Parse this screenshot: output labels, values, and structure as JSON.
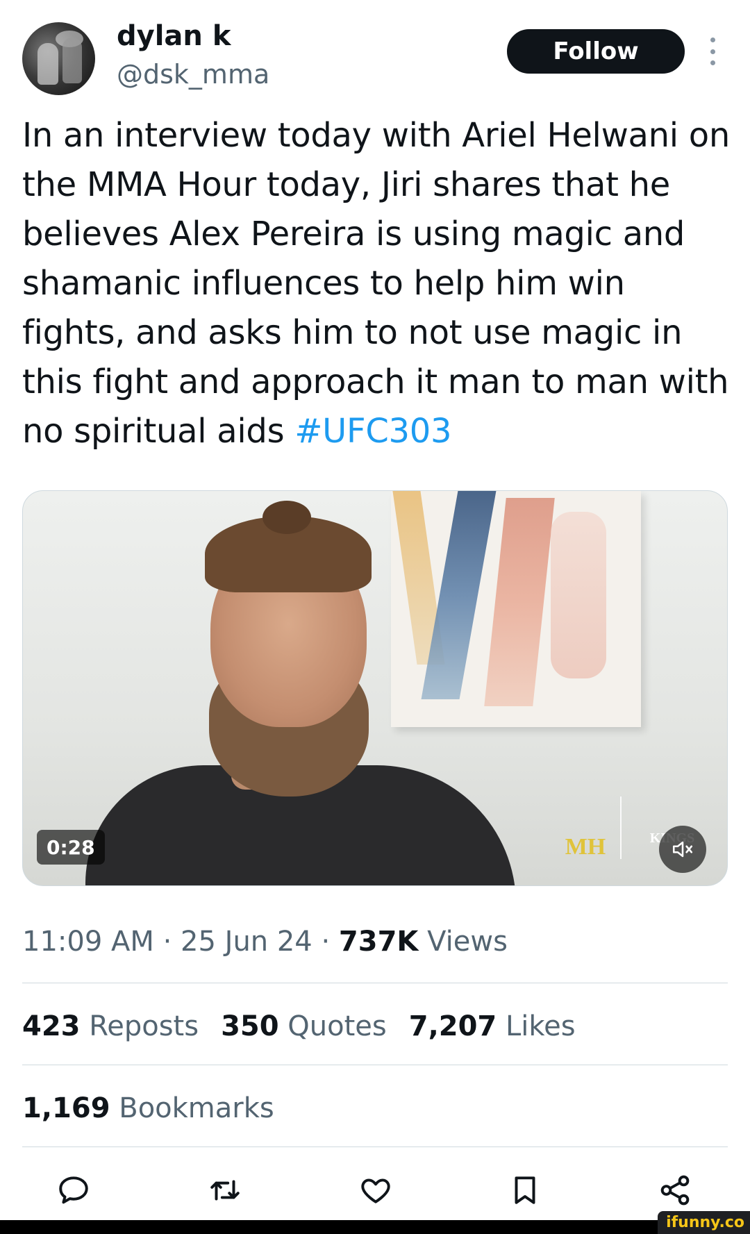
{
  "author": {
    "name": "dylan k",
    "handle": "@dsk_mma"
  },
  "header": {
    "follow_label": "Follow"
  },
  "tweet": {
    "text": "In an interview today with Ariel Helwani on the MMA Hour today, Jiri shares that he believes Alex Pereira is using magic and shamanic influences to help him win fights, and asks him to not use magic in this fight and approach it man to man with no spiritual aids ",
    "hashtag": "#UFC303"
  },
  "video": {
    "duration": "0:28",
    "overlay_logo_left": "MH",
    "overlay_logo_right": "KINGS"
  },
  "meta": {
    "time": "11:09 AM",
    "date": "25 Jun 24",
    "views_count": "737K",
    "views_label": "Views",
    "separator": "·"
  },
  "stats": {
    "reposts_count": "423",
    "reposts_label": "Reposts",
    "quotes_count": "350",
    "quotes_label": "Quotes",
    "likes_count": "7,207",
    "likes_label": "Likes",
    "bookmarks_count": "1,169",
    "bookmarks_label": "Bookmarks"
  },
  "actions": [
    {
      "icon": "reply-icon"
    },
    {
      "icon": "repost-icon"
    },
    {
      "icon": "like-icon"
    },
    {
      "icon": "bookmark-icon"
    },
    {
      "icon": "share-icon"
    }
  ],
  "watermark": {
    "text": "ifunny.co"
  },
  "colors": {
    "text_primary": "#0f1419",
    "text_secondary": "#536471",
    "link": "#1d9bf0",
    "divider": "#cfd9de",
    "follow_bg": "#0f1419"
  }
}
